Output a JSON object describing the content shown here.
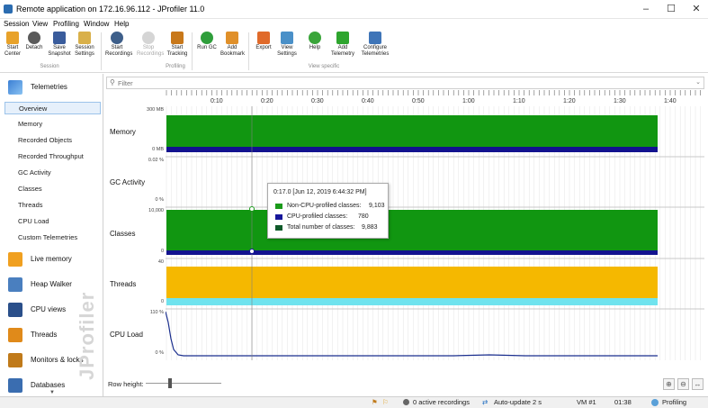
{
  "window": {
    "title": "Remote application on 172.16.96.112 - JProfiler 11.0"
  },
  "menu": [
    "Session",
    "View",
    "Profiling",
    "Window",
    "Help"
  ],
  "toolbar": {
    "buttons": [
      {
        "label": "Start\nCenter",
        "icon": "start-center-icon"
      },
      {
        "label": "Detach",
        "icon": "detach-icon"
      },
      {
        "label": "Save\nSnapshot",
        "icon": "save-icon"
      },
      {
        "label": "Session\nSettings",
        "icon": "session-settings-icon"
      },
      {
        "label": "Start\nRecordings",
        "icon": "start-recordings-icon"
      },
      {
        "label": "Stop\nRecordings",
        "icon": "stop-recordings-icon"
      },
      {
        "label": "Start\nTracking",
        "icon": "start-tracking-icon"
      },
      {
        "label": "Run GC",
        "icon": "run-gc-icon"
      },
      {
        "label": "Add\nBookmark",
        "icon": "bookmark-icon"
      },
      {
        "label": "Export",
        "icon": "export-icon"
      },
      {
        "label": "View\nSettings",
        "icon": "view-settings-icon"
      },
      {
        "label": "Help",
        "icon": "help-icon"
      },
      {
        "label": "Add\nTelemetry",
        "icon": "add-telemetry-icon"
      },
      {
        "label": "Configure\nTelemetries",
        "icon": "configure-telemetries-icon"
      }
    ],
    "groups": [
      "Session",
      "Profiling",
      "View specific"
    ]
  },
  "sidebar": {
    "sections": [
      {
        "label": "Telemetries",
        "icon": "telemetries-icon"
      },
      {
        "label": "Live memory",
        "icon": "live-memory-icon"
      },
      {
        "label": "Heap Walker",
        "icon": "heap-walker-icon"
      },
      {
        "label": "CPU views",
        "icon": "cpu-views-icon"
      },
      {
        "label": "Threads",
        "icon": "threads-icon"
      },
      {
        "label": "Monitors & locks",
        "icon": "monitors-locks-icon"
      },
      {
        "label": "Databases",
        "icon": "databases-icon"
      }
    ],
    "telemetry_items": [
      "Overview",
      "Memory",
      "Recorded Objects",
      "Recorded Throughput",
      "GC Activity",
      "Classes",
      "Threads",
      "CPU Load",
      "Custom Telemetries"
    ],
    "selected": "Overview",
    "watermark": "JProfiler"
  },
  "filter": {
    "placeholder": "Filter"
  },
  "time_axis": {
    "ticks": [
      "0:10",
      "0:20",
      "0:30",
      "0:40",
      "0:50",
      "1:00",
      "1:10",
      "1:20",
      "1:30",
      "1:40"
    ]
  },
  "lanes": [
    {
      "label": "Memory",
      "ymax": "300 MB",
      "ymin": "0 MB"
    },
    {
      "label": "GC Activity",
      "ymax": "0.02 %",
      "ymin": "0 %"
    },
    {
      "label": "Classes",
      "ymax": "10,000",
      "ymin": "0"
    },
    {
      "label": "Threads",
      "ymax": "40",
      "ymin": "0"
    },
    {
      "label": "CPU Load",
      "ymax": "110 %",
      "ymin": "0 %"
    }
  ],
  "tooltip": {
    "header": "0:17.0 [Jun 12, 2019 6:44:32 PM]",
    "rows": [
      {
        "label": "Non-CPU-profiled classes:",
        "value": "9,103",
        "color": "#1a9a1a"
      },
      {
        "label": "CPU-profiled classes:",
        "value": "780",
        "color": "#16169a"
      },
      {
        "label": "Total number of classes:",
        "value": "9,883",
        "color": "#0f5a2a"
      }
    ]
  },
  "colors": {
    "green": "#119611",
    "navy": "#12128f",
    "orange": "#f5b800",
    "cyan": "#6fe3ee",
    "cpu_line": "#1b2f8e"
  },
  "row_height_label": "Row height:",
  "status": {
    "recordings": "0 active recordings",
    "autoupdate": "Auto-update 2 s",
    "vm": "VM #1",
    "time": "01:38",
    "mode": "Profiling"
  }
}
